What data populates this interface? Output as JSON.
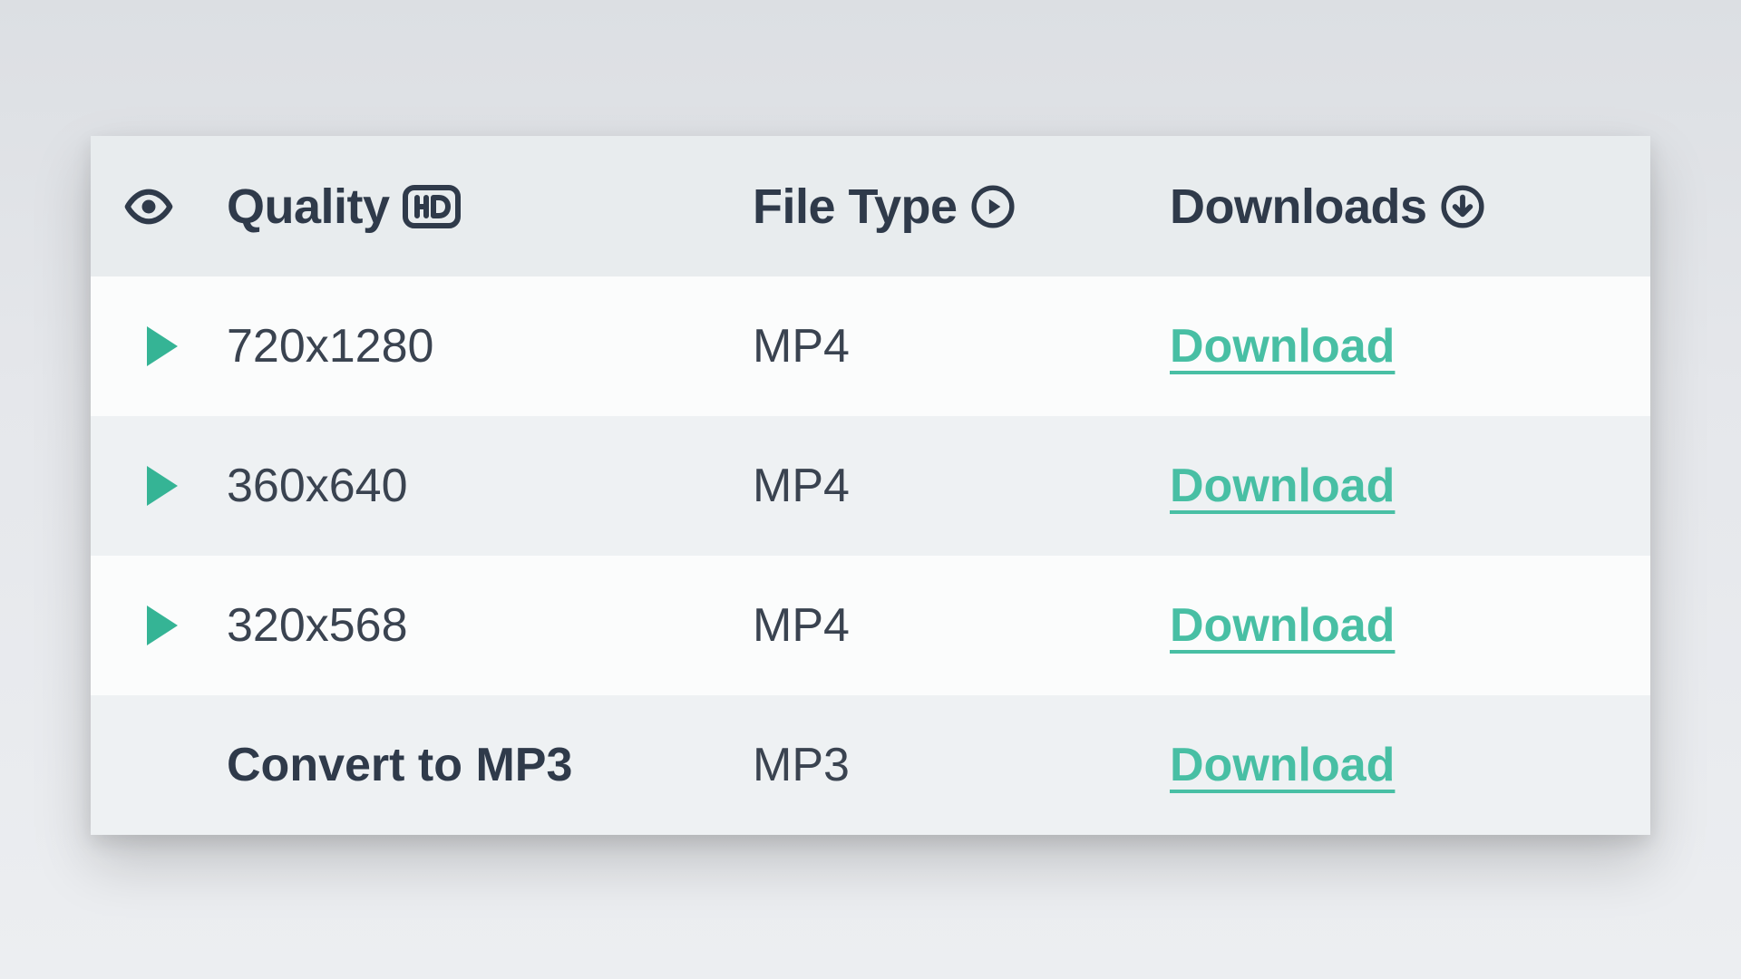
{
  "header": {
    "quality_label": "Quality",
    "filetype_label": "File Type",
    "downloads_label": "Downloads"
  },
  "rows": [
    {
      "quality": "720x1280",
      "filetype": "MP4",
      "download": "Download",
      "bold": false,
      "play": true
    },
    {
      "quality": "360x640",
      "filetype": "MP4",
      "download": "Download",
      "bold": false,
      "play": true
    },
    {
      "quality": "320x568",
      "filetype": "MP4",
      "download": "Download",
      "bold": false,
      "play": true
    },
    {
      "quality": "Convert to MP3",
      "filetype": "MP3",
      "download": "Download",
      "bold": true,
      "play": false
    }
  ],
  "colors": {
    "accent": "#48bfa4",
    "text": "#2f3a4a"
  }
}
